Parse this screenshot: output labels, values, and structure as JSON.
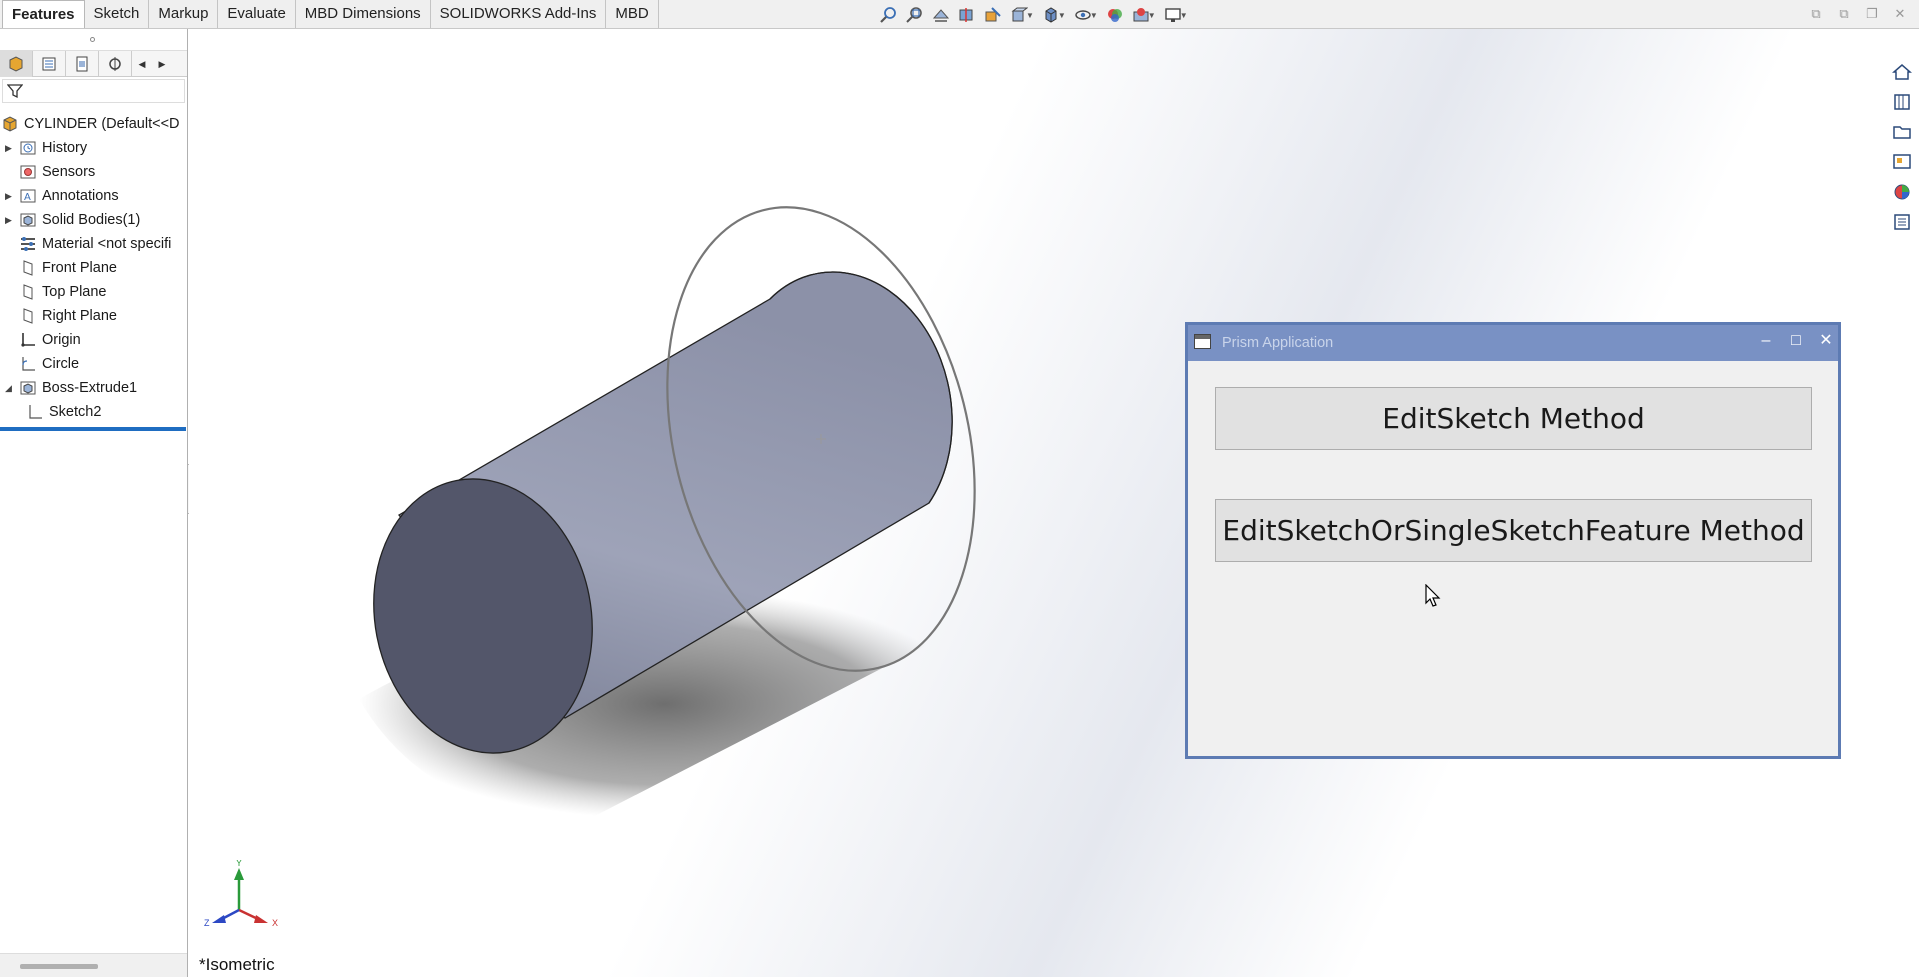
{
  "command_tabs": [
    "Features",
    "Sketch",
    "Markup",
    "Evaluate",
    "MBD Dimensions",
    "SOLIDWORKS Add-Ins",
    "MBD"
  ],
  "active_tab": "Features",
  "tree": {
    "root": "CYLINDER  (Default<<D",
    "items": [
      {
        "label": "History",
        "expandable": true,
        "icon": "history-icon"
      },
      {
        "label": "Sensors",
        "expandable": false,
        "icon": "sensors-icon"
      },
      {
        "label": "Annotations",
        "expandable": true,
        "icon": "annotations-icon"
      },
      {
        "label": "Solid Bodies(1)",
        "expandable": true,
        "icon": "solid-bodies-icon"
      },
      {
        "label": "Material <not specifi",
        "expandable": false,
        "icon": "material-icon"
      },
      {
        "label": "Front Plane",
        "expandable": false,
        "icon": "plane-icon"
      },
      {
        "label": "Top Plane",
        "expandable": false,
        "icon": "plane-icon"
      },
      {
        "label": "Right Plane",
        "expandable": false,
        "icon": "plane-icon"
      },
      {
        "label": "Origin",
        "expandable": false,
        "icon": "origin-icon"
      },
      {
        "label": "Circle",
        "expandable": false,
        "icon": "sketch-icon"
      },
      {
        "label": "Boss-Extrude1",
        "expandable": true,
        "expanded": true,
        "icon": "extrude-icon"
      },
      {
        "label": "Sketch2",
        "child": true,
        "icon": "sketch-icon"
      }
    ]
  },
  "viewport": {
    "view_label": "*Isometric",
    "triad": {
      "x": "X",
      "y": "Y",
      "z": "Z"
    }
  },
  "dialog": {
    "title": "Prism Application",
    "buttons": [
      "EditSketch Method",
      "EditSketchOrSingleSketchFeature Method"
    ],
    "controls": {
      "minimize": "–",
      "maximize": "□",
      "close": "✕"
    }
  }
}
